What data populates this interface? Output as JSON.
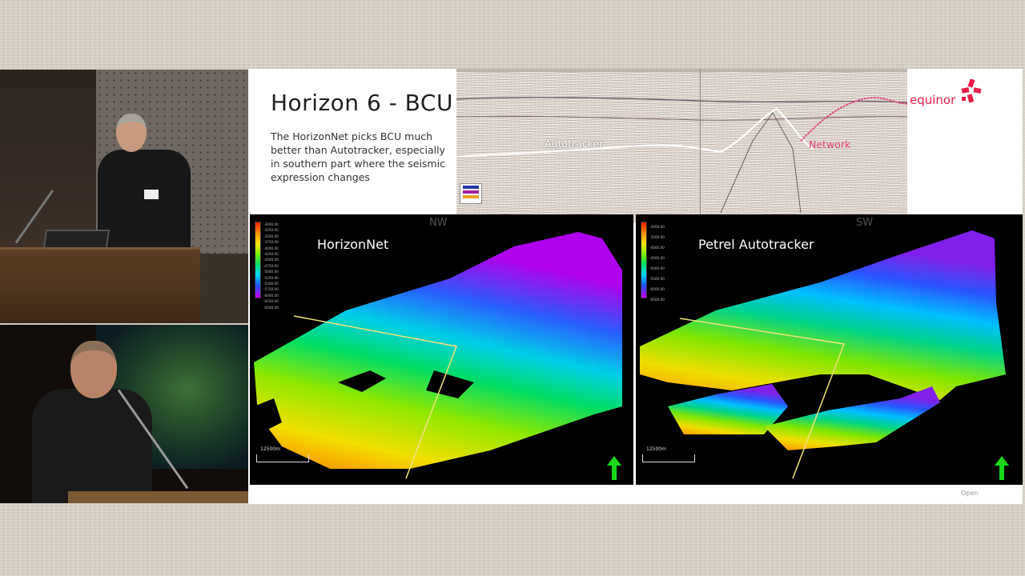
{
  "slide": {
    "title": "Horizon 6 - BCU",
    "description": "The HorizonNet picks BCU much better than Autotracker, especially in southern part where the seismic expression changes",
    "seismic_section": {
      "autotracker_label": "Autotracker",
      "network_label": "Network"
    },
    "logo_text": "equinor",
    "maps": [
      {
        "title": "HorizonNet",
        "corner_label": "NW",
        "scale_label": "12500m",
        "color_scale_ticks": [
          "-3000.00",
          "-3250.00",
          "-3500.00",
          "-3750.00",
          "-4000.00",
          "-4250.00",
          "-4500.00",
          "-4750.00",
          "-5000.00",
          "-5250.00",
          "-5500.00",
          "-5750.00",
          "-6000.00",
          "-6250.00",
          "-6500.00"
        ]
      },
      {
        "title": "Petrel Autotracker",
        "corner_label": "SW",
        "scale_label": "12500m",
        "color_scale_ticks": [
          "-3000.00",
          "-3500.00",
          "-4000.00",
          "-4500.00",
          "-5000.00",
          "-5500.00",
          "-6000.00",
          "-6500.00"
        ]
      }
    ],
    "classification": "Open"
  },
  "colors": {
    "brand": "#ea1e4a",
    "network_pick": "#e0447a",
    "north_arrow": "#19d919",
    "section_line": "#f2e37a"
  }
}
